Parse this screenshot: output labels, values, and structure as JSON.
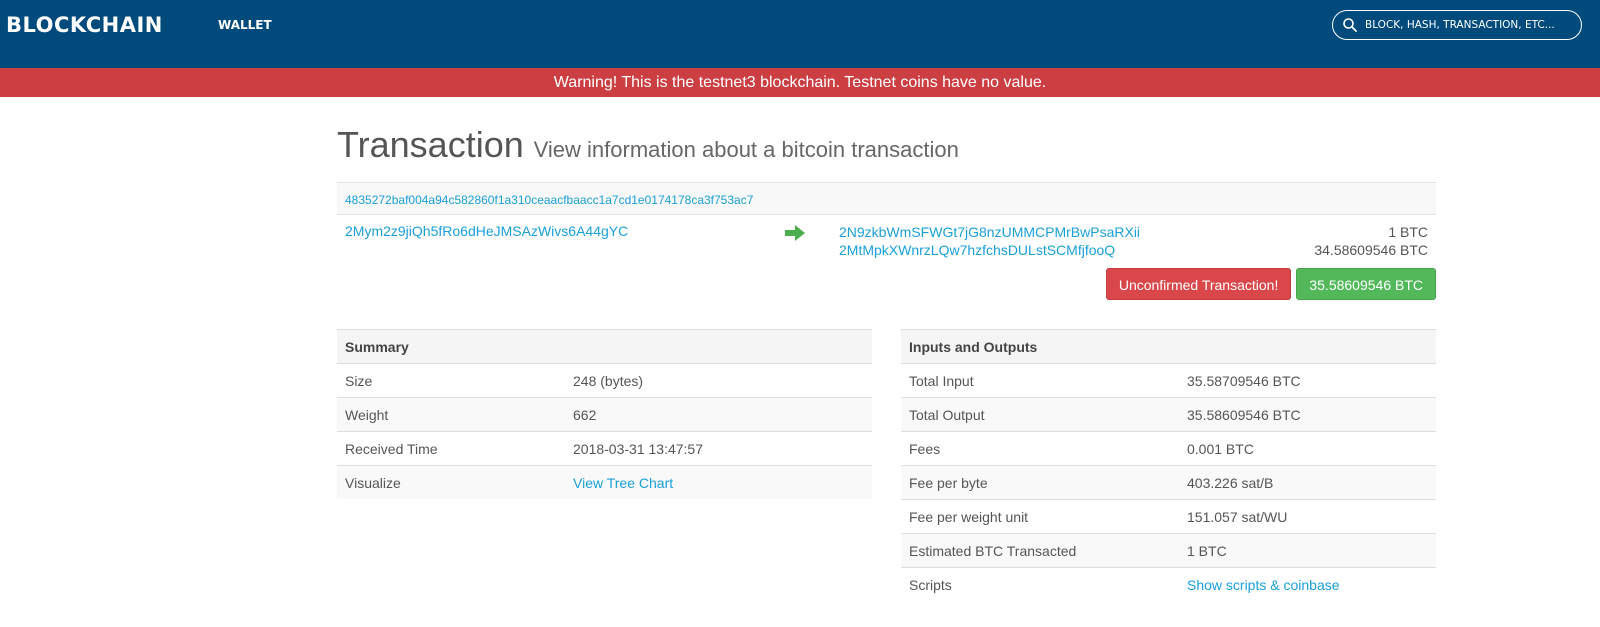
{
  "header": {
    "logo": "BLOCKCHAIN",
    "nav_wallet": "WALLET",
    "search_placeholder": "BLOCK, HASH, TRANSACTION, ETC..."
  },
  "warning": "Warning! This is the testnet3 blockchain. Testnet coins have no value.",
  "page": {
    "title": "Transaction",
    "subtitle": "View information about a bitcoin transaction"
  },
  "transaction": {
    "hash": "4835272baf004a94c582860f1a310ceaacfbaacc1a7cd1e0174178ca3f753ac7",
    "from_address": "2Mym2z9jiQh5fRo6dHeJMSAzWivs6A44gYC",
    "outputs": [
      {
        "address": "2N9zkbWmSFWGt7jG8nzUMMCPMrBwPsaRXii",
        "amount": "1 BTC"
      },
      {
        "address": "2MtMpkXWnrzLQw7hzfchsDULstSCMfjfooQ",
        "amount": "34.58609546 BTC"
      }
    ],
    "status_badge": "Unconfirmed Transaction!",
    "total_badge": "35.58609546 BTC"
  },
  "summary": {
    "heading": "Summary",
    "rows": [
      {
        "label": "Size",
        "value": "248 (bytes)"
      },
      {
        "label": "Weight",
        "value": "662"
      },
      {
        "label": "Received Time",
        "value": "2018-03-31 13:47:57"
      },
      {
        "label": "Visualize",
        "value": "View Tree Chart"
      }
    ]
  },
  "io": {
    "heading": "Inputs and Outputs",
    "rows": [
      {
        "label": "Total Input",
        "value": "35.58709546 BTC"
      },
      {
        "label": "Total Output",
        "value": "35.58609546 BTC"
      },
      {
        "label": "Fees",
        "value": "0.001 BTC"
      },
      {
        "label": "Fee per byte",
        "value": "403.226 sat/B"
      },
      {
        "label": "Fee per weight unit",
        "value": "151.057 sat/WU"
      },
      {
        "label": "Estimated BTC Transacted",
        "value": "1 BTC"
      },
      {
        "label": "Scripts",
        "value": "Show scripts & coinbase"
      }
    ]
  },
  "colors": {
    "header_bg": "#004a7c",
    "warning_bg": "#cb3e42",
    "link": "#1aa0d9",
    "badge_red": "#d9474a",
    "badge_green": "#53b85a"
  }
}
